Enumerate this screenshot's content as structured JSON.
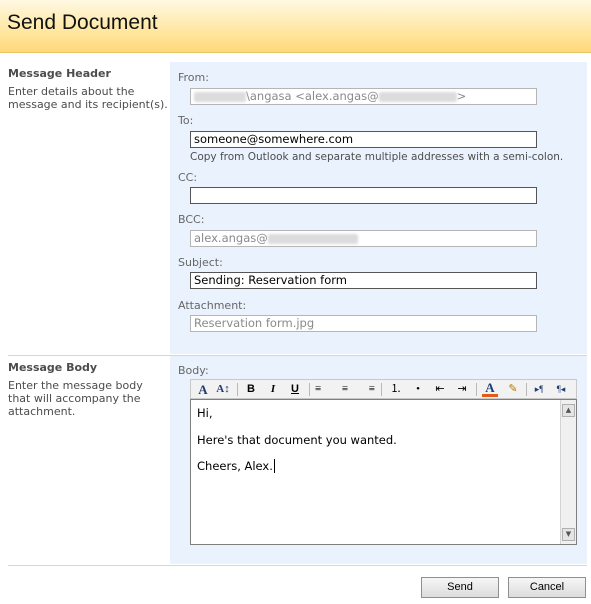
{
  "page": {
    "title": "Send Document"
  },
  "header_section": {
    "title": "Message Header",
    "description": "Enter details about the message and its recipient(s).",
    "from": {
      "label": "From:",
      "value_visible": "\\angasa <alex.angas@",
      "value_end": ">"
    },
    "to": {
      "label": "To:",
      "value": "someone@somewhere.com",
      "hint": "Copy from Outlook and separate multiple addresses with a semi-colon."
    },
    "cc": {
      "label": "CC:",
      "value": ""
    },
    "bcc": {
      "label": "BCC:",
      "value_visible": "alex.angas@"
    },
    "subject": {
      "label": "Subject:",
      "value": "Sending: Reservation form"
    },
    "attachment": {
      "label": "Attachment:",
      "value": "Reservation form.jpg"
    }
  },
  "body_section": {
    "title": "Message Body",
    "description": "Enter the message body that will accompany the attachment.",
    "label": "Body:",
    "lines": [
      "Hi,",
      "Here's that document you wanted.",
      "Cheers, Alex."
    ]
  },
  "toolbar": {
    "buttons": [
      {
        "name": "font-icon",
        "glyph": "A"
      },
      {
        "name": "font-size-icon",
        "glyph": "A↕"
      },
      {
        "name": "bold-icon",
        "glyph": "B"
      },
      {
        "name": "italic-icon",
        "glyph": "I"
      },
      {
        "name": "underline-icon",
        "glyph": "U"
      },
      {
        "name": "align-left-icon",
        "glyph": "≡"
      },
      {
        "name": "align-center-icon",
        "glyph": "≡"
      },
      {
        "name": "align-right-icon",
        "glyph": "≡"
      },
      {
        "name": "numbered-list-icon",
        "glyph": "⒈"
      },
      {
        "name": "bulleted-list-icon",
        "glyph": "•"
      },
      {
        "name": "decrease-indent-icon",
        "glyph": "⇤"
      },
      {
        "name": "increase-indent-icon",
        "glyph": "⇥"
      },
      {
        "name": "text-color-icon",
        "glyph": "A"
      },
      {
        "name": "highlight-icon",
        "glyph": "✎"
      },
      {
        "name": "ltr-icon",
        "glyph": "▸¶"
      },
      {
        "name": "rtl-icon",
        "glyph": "¶◂"
      }
    ]
  },
  "actions": {
    "send": "Send",
    "cancel": "Cancel"
  },
  "colors": {
    "title_band": "#ffe8a6",
    "panel_bg": "#eaf3fd",
    "accent_underline": "#e05a1a"
  }
}
